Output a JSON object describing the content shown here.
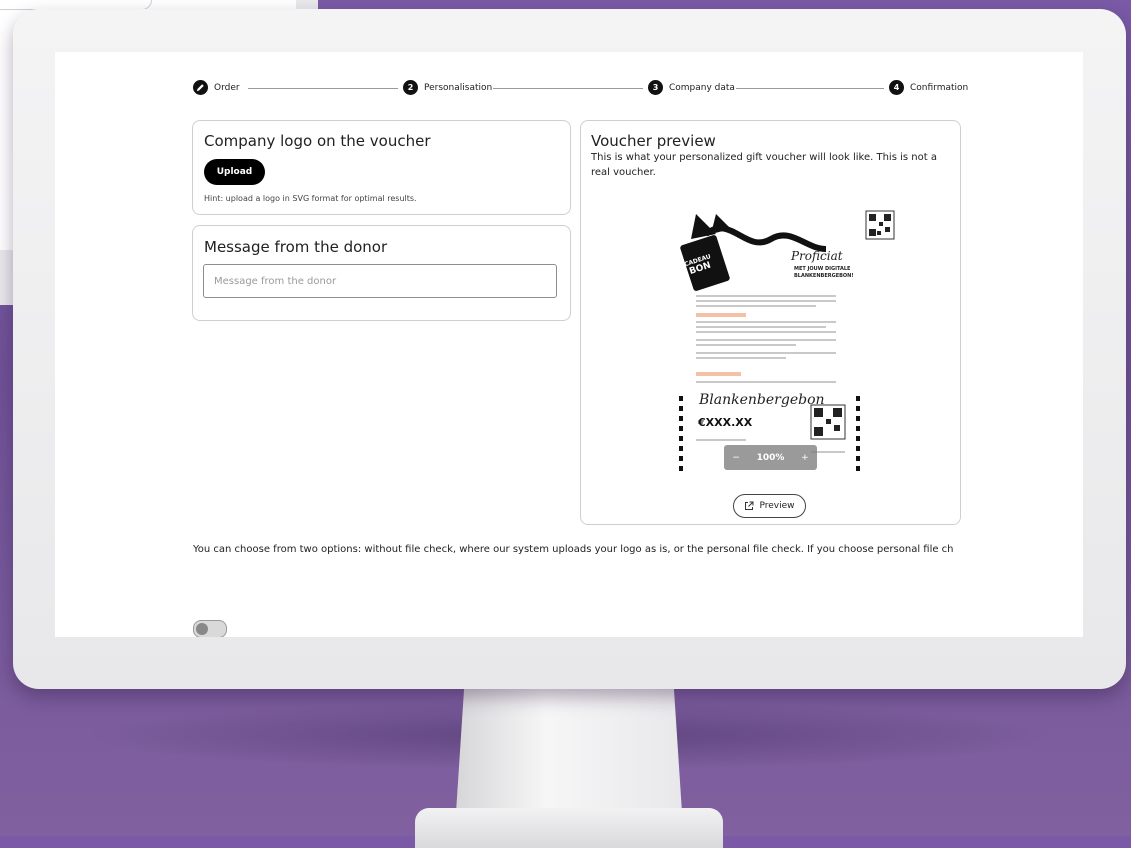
{
  "stepper": {
    "steps": [
      {
        "label": "Order",
        "state": "done"
      },
      {
        "label": "Personalisation",
        "number": "2"
      },
      {
        "label": "Company data",
        "number": "3"
      },
      {
        "label": "Confirmation",
        "number": "4"
      }
    ]
  },
  "logo_card": {
    "title": "Company logo on the voucher",
    "upload_label": "Upload",
    "hint": "Hint: upload a logo in SVG format for optimal results."
  },
  "message_card": {
    "title": "Message from the donor",
    "placeholder": "Message from the donor"
  },
  "preview_card": {
    "title": "Voucher preview",
    "subtitle": "This is what your personalized gift voucher will look like. This is not a real voucher.",
    "voucher": {
      "tag_line1": "CADEAU",
      "tag_line2": "BON",
      "greeting": "Proficiat",
      "headline1": "MET JOUW DIGITALE",
      "headline2": "BLANKENBERGEBON!",
      "brand_script": "Blankenbergebon",
      "amount": "€XXX.XX"
    },
    "zoom": {
      "minus": "−",
      "level": "100%",
      "plus": "+"
    },
    "preview_label": "Preview"
  },
  "bottom_text": "You can choose from two options: without file check, where our system uploads your logo as is, or the personal file check. If you choose personal file check",
  "colors": {
    "background": "#7a5aa6",
    "accent": "#000000",
    "highlight": "#f3c2a6"
  }
}
